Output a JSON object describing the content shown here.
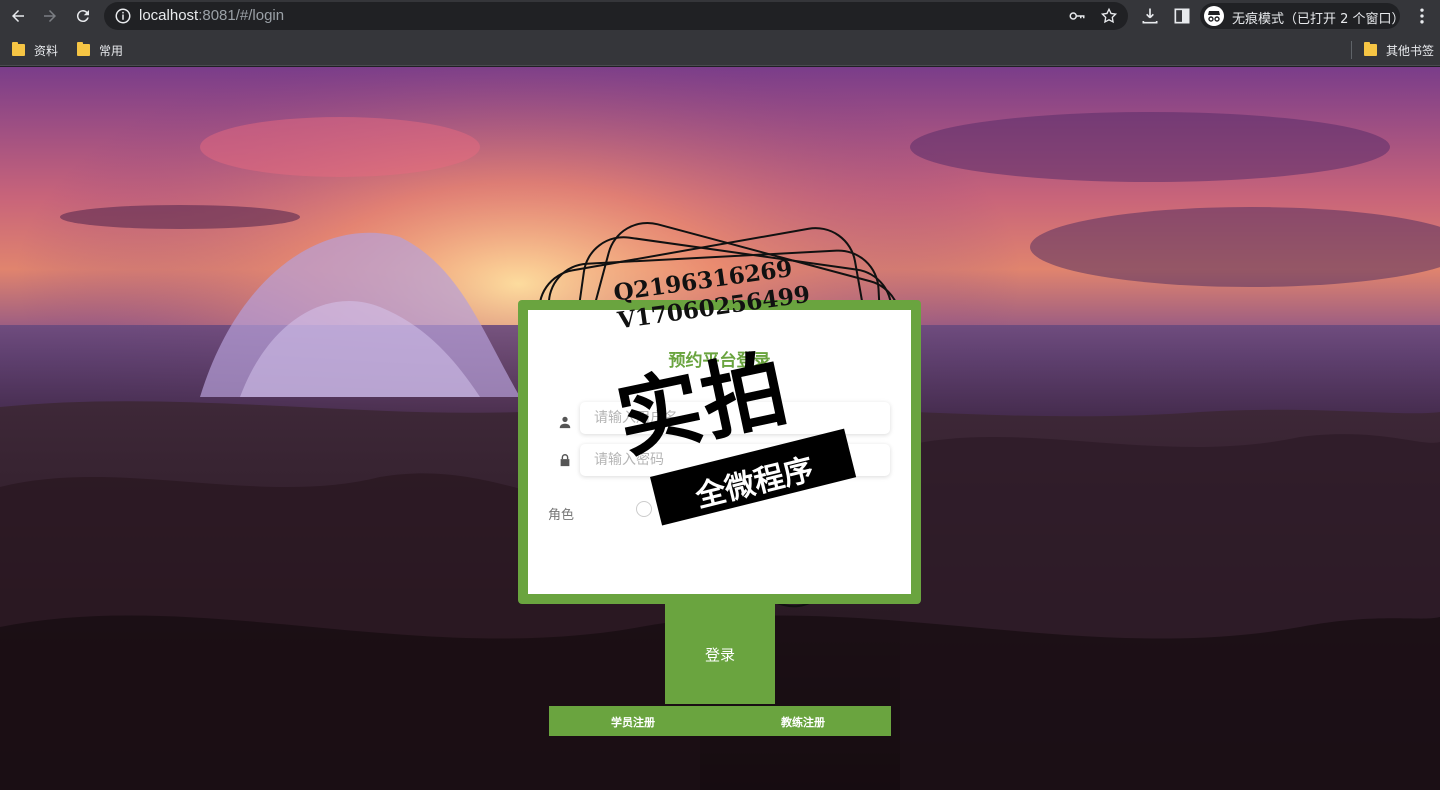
{
  "browser": {
    "url_host": "localhost",
    "url_rest": ":8081/#/login",
    "incognito_label": "无痕模式（已打开 2 个窗口）",
    "bookmarks": [
      {
        "label": "资料"
      },
      {
        "label": "常用"
      }
    ],
    "other_bookmarks": "其他书签"
  },
  "login": {
    "title": "预约平台登录",
    "username_placeholder": "请输入用户名",
    "password_placeholder": "请输入密码",
    "role_label": "角色",
    "login_button": "登录",
    "register_student": "学员注册",
    "register_coach": "教练注册"
  },
  "watermark": {
    "line1": "Q2196316269",
    "line2": "V17060256499",
    "big_text": "实拍",
    "banner_text": "全微程序"
  },
  "colors": {
    "accent": "#6aa43f"
  }
}
